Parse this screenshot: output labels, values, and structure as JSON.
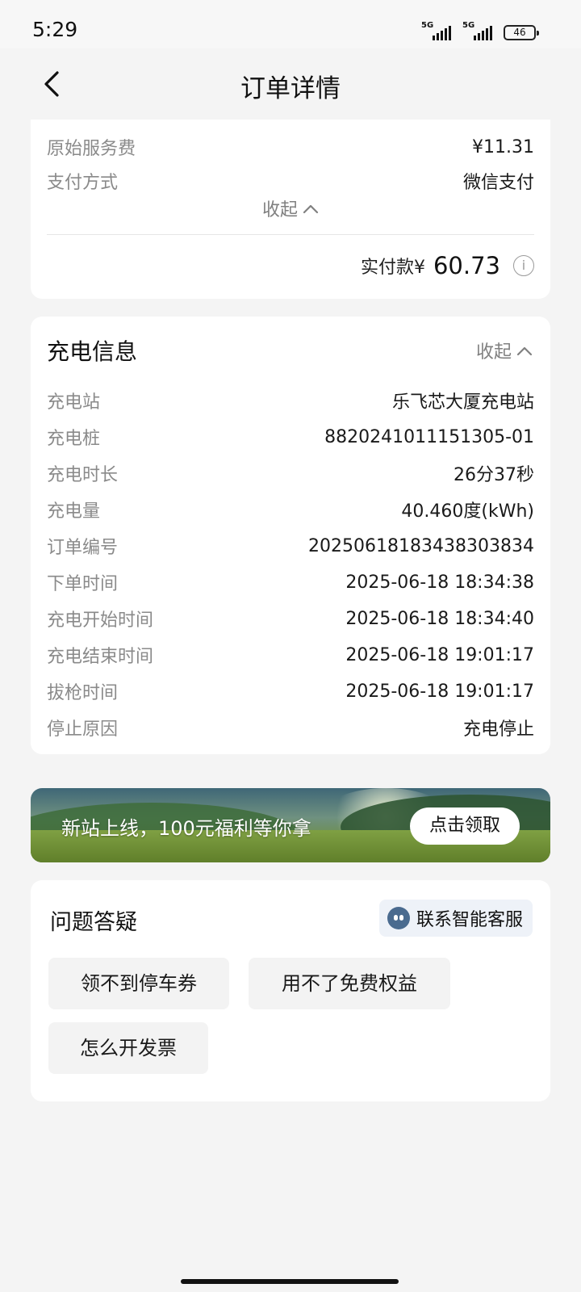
{
  "status_bar": {
    "time": "5:29",
    "signal1": "5G",
    "signal2": "5G",
    "battery": "46"
  },
  "header": {
    "title": "订单详情"
  },
  "payment": {
    "rows": [
      {
        "label": "原始服务费",
        "value": "¥11.31"
      },
      {
        "label": "支付方式",
        "value": "微信支付"
      }
    ],
    "collapse_label": "收起",
    "paid_label": "实付款¥",
    "paid_amount": "60.73"
  },
  "charging_info": {
    "title": "充电信息",
    "collapse_label": "收起",
    "rows": [
      {
        "label": "充电站",
        "value": "乐飞芯大厦充电站"
      },
      {
        "label": "充电桩",
        "value": "8820241011151305-01"
      },
      {
        "label": "充电时长",
        "value": "26分37秒"
      },
      {
        "label": "充电量",
        "value": "40.460度(kWh)"
      },
      {
        "label": "订单编号",
        "value": "20250618183438303834"
      },
      {
        "label": "下单时间",
        "value": "2025-06-18 18:34:38"
      },
      {
        "label": "充电开始时间",
        "value": "2025-06-18 18:34:40"
      },
      {
        "label": "充电结束时间",
        "value": "2025-06-18 19:01:17"
      },
      {
        "label": "拔枪时间",
        "value": "2025-06-18 19:01:17"
      },
      {
        "label": "停止原因",
        "value": "充电停止"
      }
    ]
  },
  "banner": {
    "text": "新站上线，100元福利等你拿",
    "button": "点击领取"
  },
  "faq": {
    "title": "问题答疑",
    "support_button": "联系智能客服",
    "chips": [
      "领不到停车券",
      "用不了免费权益",
      "怎么开发票"
    ]
  }
}
